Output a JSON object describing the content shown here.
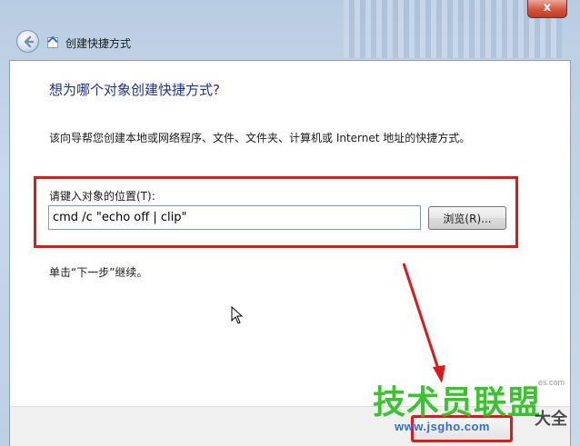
{
  "window": {
    "title": "创建快捷方式",
    "close_label": "x"
  },
  "wizard": {
    "heading": "想为哪个对象创建快捷方式?",
    "description": "该向导帮您创建本地或网络程序、文件、文件夹、计算机或 Internet 地址的快捷方式。",
    "location_label": "请键入对象的位置(T):",
    "location_value": "cmd /c \"echo off | clip\"",
    "browse_label": "浏览(R)...",
    "hint": "单击“下一步”继续。"
  },
  "watermark": {
    "brand": "技术员联盟",
    "brand_tail": "大全",
    "url": "www.jsgho.com",
    "faint": "es.com"
  },
  "colors": {
    "highlight": "#e01818",
    "heading": "#1e3287",
    "watermark_green": "#2bbf1f"
  },
  "icons": [
    "back-arrow-icon",
    "shortcut-app-icon",
    "mouse-cursor-icon",
    "red-arrow-annotation"
  ]
}
